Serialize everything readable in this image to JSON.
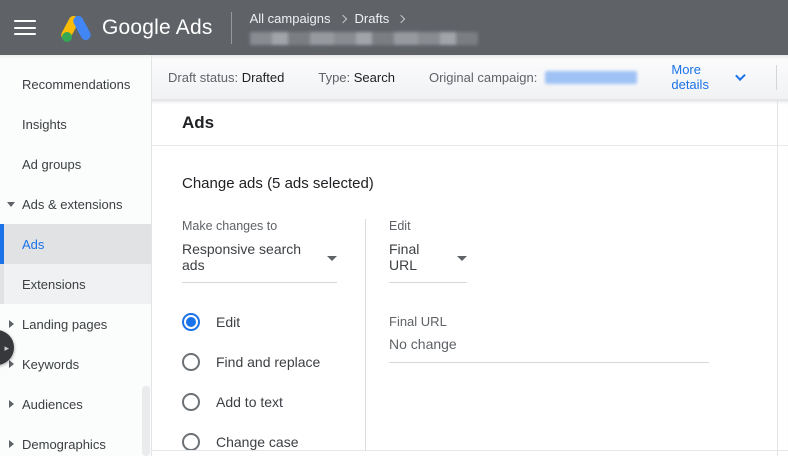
{
  "header": {
    "logo_text": "Google Ads",
    "breadcrumb": {
      "level1": "All campaigns",
      "level2": "Drafts"
    }
  },
  "subheader": {
    "draft_status_label": "Draft status:",
    "draft_status_value": "Drafted",
    "type_label": "Type:",
    "type_value": "Search",
    "original_campaign_label": "Original campaign:",
    "more_details_label": "More details"
  },
  "sidebar": {
    "items": [
      {
        "label": "Recommendations"
      },
      {
        "label": "Insights"
      },
      {
        "label": "Ad groups"
      },
      {
        "label": "Ads & extensions",
        "expanded": true
      },
      {
        "label": "Ads",
        "selected": true
      },
      {
        "label": "Extensions"
      },
      {
        "label": "Landing pages"
      },
      {
        "label": "Keywords"
      },
      {
        "label": "Audiences"
      },
      {
        "label": "Demographics"
      }
    ]
  },
  "main": {
    "title": "Ads",
    "section_title": "Change ads (5 ads selected)",
    "make_changes": {
      "label": "Make changes to",
      "value": "Responsive search ads"
    },
    "edit_dropdown": {
      "label": "Edit",
      "value": "Final URL"
    },
    "radios": [
      {
        "label": "Edit",
        "selected": true
      },
      {
        "label": "Find and replace",
        "selected": false
      },
      {
        "label": "Add to text",
        "selected": false
      },
      {
        "label": "Change case",
        "selected": false
      }
    ],
    "final_url": {
      "label": "Final URL",
      "value": "No change"
    }
  },
  "colors": {
    "accent_blue": "#1a73e8",
    "header_bg": "#5f6368",
    "logo_yellow": "#fbbc04",
    "logo_blue": "#4285f4",
    "logo_green": "#34a853"
  }
}
